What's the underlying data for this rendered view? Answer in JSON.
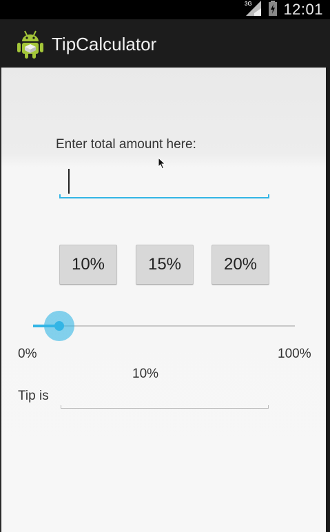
{
  "status_bar": {
    "network": "3G",
    "time": "12:01"
  },
  "action_bar": {
    "title": "TipCalculator",
    "icon": "android-robot-icon"
  },
  "form": {
    "prompt": "Enter total amount here:",
    "amount_value": "",
    "buttons": [
      "10%",
      "15%",
      "20%"
    ],
    "slider": {
      "min_label": "0%",
      "max_label": "100%",
      "value_percent": 10,
      "value_label": "10%"
    },
    "tip_label": "Tip is",
    "tip_value": ""
  },
  "colors": {
    "accent": "#33b5e5",
    "action_bar": "#1c1c1c",
    "background": "#f5f5f5"
  }
}
